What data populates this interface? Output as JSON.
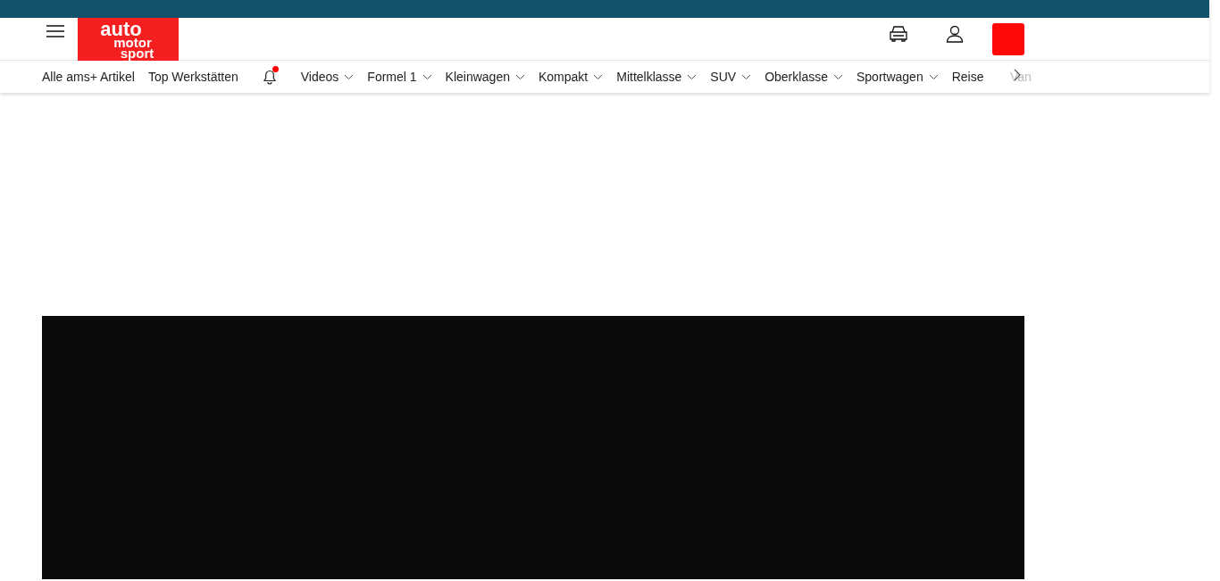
{
  "logo": {
    "lines": [
      "auto",
      "motor",
      "sport"
    ]
  },
  "nav": {
    "items": [
      {
        "kind": "link",
        "label": "Alle ams+ Artikel"
      },
      {
        "kind": "link",
        "label": "Top Werkstätten"
      },
      {
        "kind": "bell",
        "unread": true
      },
      {
        "kind": "dropdown",
        "label": "Videos"
      },
      {
        "kind": "dropdown",
        "label": "Formel 1"
      },
      {
        "kind": "dropdown",
        "label": "Kleinwagen"
      },
      {
        "kind": "dropdown",
        "label": "Kompakt"
      },
      {
        "kind": "dropdown",
        "label": "Mittelklasse"
      },
      {
        "kind": "dropdown",
        "label": "SUV"
      },
      {
        "kind": "dropdown",
        "label": "Oberklasse"
      },
      {
        "kind": "dropdown",
        "label": "Sportwagen"
      },
      {
        "kind": "link",
        "label": "Reise"
      },
      {
        "kind": "faded",
        "label": "Van"
      }
    ]
  },
  "video": {
    "kind": "player"
  }
}
